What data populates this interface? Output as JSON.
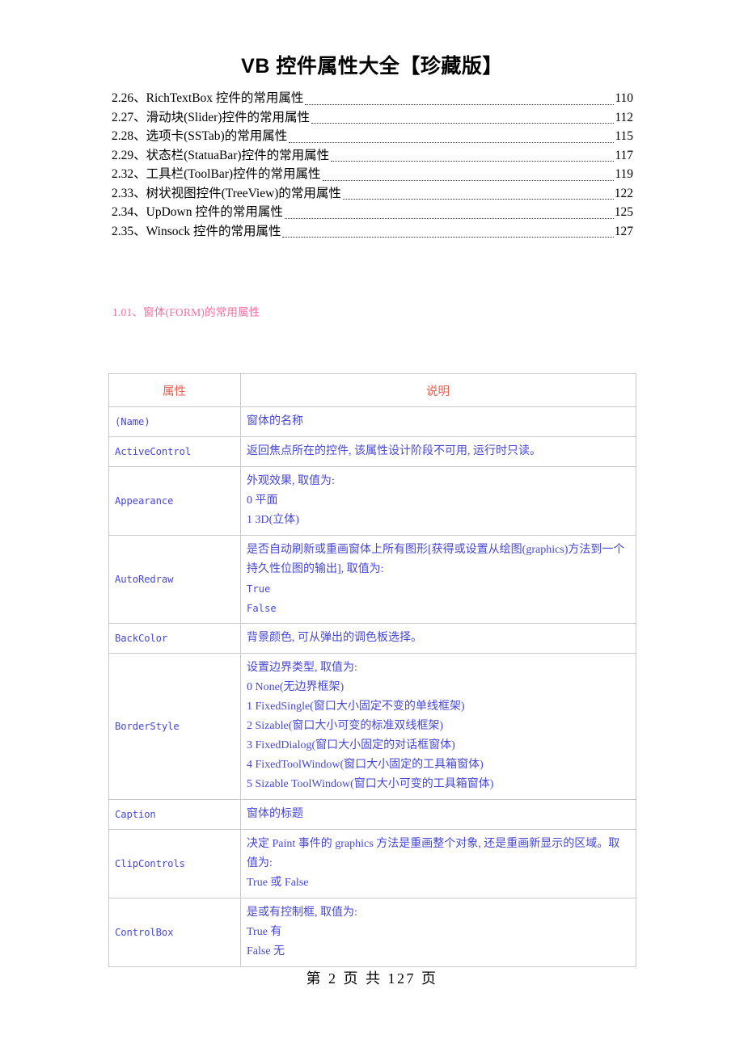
{
  "document": {
    "title": "VB 控件属性大全【珍藏版】"
  },
  "toc": {
    "items": [
      {
        "label": "2.26、RichTextBox 控件的常用属性",
        "page": "110"
      },
      {
        "label": "2.27、滑动块(Slider)控件的常用属性",
        "page": "112"
      },
      {
        "label": "2.28、选项卡(SSTab)的常用属性",
        "page": "115"
      },
      {
        "label": "2.29、状态栏(StatuaBar)控件的常用属性",
        "page": "117"
      },
      {
        "label": "2.32、工具栏(ToolBar)控件的常用属性",
        "page": "119"
      },
      {
        "label": "2.33、树状视图控件(TreeView)的常用属性",
        "page": "122"
      },
      {
        "label": "2.34、UpDown 控件的常用属性",
        "page": "125"
      },
      {
        "label": "2.35、Winsock 控件的常用属性",
        "page": "127"
      }
    ]
  },
  "section": {
    "heading": "1.01、窗体(FORM)的常用属性",
    "heading_color": "#f4709f"
  },
  "table": {
    "header_color": "#e8604f",
    "body_color": "#4747d6",
    "border_color": "#c8c8c8",
    "columns": [
      "属性",
      "说明"
    ],
    "rows": [
      {
        "property": "(Name)",
        "lines": [
          {
            "text": "窗体的名称",
            "mono": false
          }
        ]
      },
      {
        "property": "ActiveControl",
        "lines": [
          {
            "text": "返回焦点所在的控件, 该属性设计阶段不可用, 运行时只读。",
            "mono": false
          }
        ]
      },
      {
        "property": "Appearance",
        "lines": [
          {
            "text": "外观效果, 取值为:",
            "mono": false
          },
          {
            "text": "0  平面",
            "mono": false
          },
          {
            "text": "1  3D(立体)",
            "mono": false
          }
        ]
      },
      {
        "property": "AutoRedraw",
        "lines": [
          {
            "text": "是否自动刷新或重画窗体上所有图形[获得或设置从绘图(graphics)方法到一个持久性位图的输出], 取值为:",
            "mono": false,
            "wrap": true
          },
          {
            "text": "True",
            "mono": true
          },
          {
            "text": "False",
            "mono": true
          }
        ]
      },
      {
        "property": "BackColor",
        "lines": [
          {
            "text": "背景颜色, 可从弹出的调色板选择。",
            "mono": false
          }
        ]
      },
      {
        "property": "BorderStyle",
        "lines": [
          {
            "text": "设置边界类型, 取值为:",
            "mono": false
          },
          {
            "text": "0 None(无边界框架)",
            "mono": false
          },
          {
            "text": "1 FixedSingle(窗口大小固定不变的单线框架)",
            "mono": false
          },
          {
            "text": "2 Sizable(窗口大小可变的标准双线框架)",
            "mono": false
          },
          {
            "text": "3 FixedDialog(窗口大小固定的对话框窗体)",
            "mono": false
          },
          {
            "text": "4 FixedToolWindow(窗口大小固定的工具箱窗体)",
            "mono": false
          },
          {
            "text": "5 Sizable ToolWindow(窗口大小可变的工具箱窗体)",
            "mono": false
          }
        ]
      },
      {
        "property": "Caption",
        "lines": [
          {
            "text": "窗体的标题",
            "mono": false
          }
        ]
      },
      {
        "property": "ClipControls",
        "lines": [
          {
            "text": "决定 Paint 事件的 graphics 方法是重画整个对象, 还是重画新显示的区域。取值为:",
            "mono": false,
            "wrap": true
          },
          {
            "text": "True 或 False",
            "mono": false
          }
        ]
      },
      {
        "property": "ControlBox",
        "lines": [
          {
            "text": "是或有控制框, 取值为:",
            "mono": false
          },
          {
            "text": "True 有",
            "mono": false
          },
          {
            "text": "False 无",
            "mono": false
          }
        ]
      }
    ]
  },
  "footer": {
    "text": "第 2 页 共 127 页"
  }
}
